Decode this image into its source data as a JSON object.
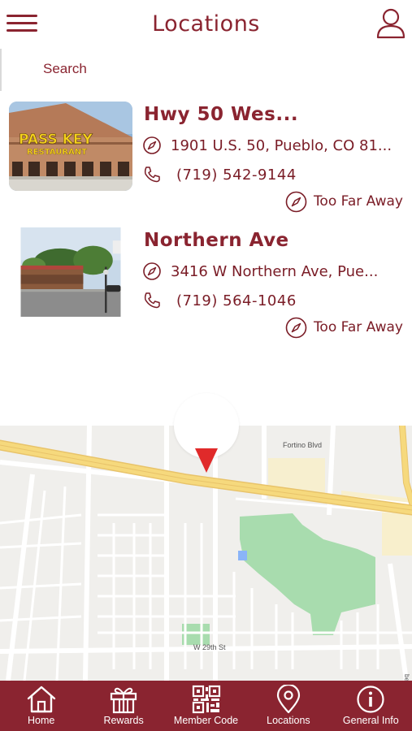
{
  "header": {
    "title": "Locations",
    "menu_icon": "hamburger-menu-icon",
    "profile_icon": "user-profile-icon"
  },
  "search": {
    "label": "Search"
  },
  "locations": [
    {
      "name": "Hwy 50 Wes...",
      "photo_sign_line1": "PASS KEY",
      "photo_sign_line2": "RESTAURANT",
      "address": "1901 U.S. 50, Pueblo, CO 81...",
      "phone": "(719) 542-9144",
      "distance": "Too Far Away"
    },
    {
      "name": "Northern Ave",
      "address": "3416 W Northern Ave, Pue...",
      "phone": "(719) 564-1046",
      "distance": "Too Far Away"
    }
  ],
  "map": {
    "street_labels": [
      "Fortino Blvd",
      "W 29th St",
      "beth St"
    ]
  },
  "nav": {
    "items": [
      {
        "label": "Home",
        "icon": "home-icon"
      },
      {
        "label": "Rewards",
        "icon": "gift-icon"
      },
      {
        "label": "Member Code",
        "icon": "qr-code-icon"
      },
      {
        "label": "Locations",
        "icon": "location-pin-icon"
      },
      {
        "label": "General Info",
        "icon": "info-icon"
      }
    ]
  },
  "colors": {
    "brand": "#8a2430",
    "map_highway": "#f5d67a",
    "map_park": "#a8dcae"
  }
}
